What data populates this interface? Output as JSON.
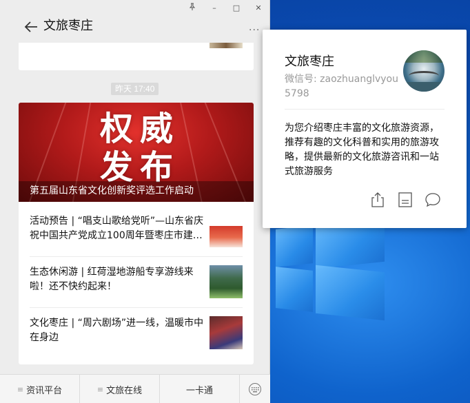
{
  "window": {
    "pin": "⊼",
    "minimize": "–",
    "maximize": "□",
    "close": "✕"
  },
  "header": {
    "title": "文旅枣庄",
    "more": "···"
  },
  "previous_card": {
    "text": "“                            ”"
  },
  "timestamp": "昨天 17:40",
  "hero": {
    "big_text_line1": "权威",
    "big_text_line2": "发布",
    "caption": "第五届山东省文化创新奖评选工作启动"
  },
  "sub_articles": [
    {
      "title": "活动预告 | “唱支山歌给党听”—山东省庆祝中国共产党成立100周年暨枣庄市建…"
    },
    {
      "title": "生态休闲游 | 红荷湿地游船专享游线来啦！还不快约起来！"
    },
    {
      "title": "文化枣庄 | “周六剧场”进一线，温暖市中在身边"
    }
  ],
  "bottom_menu": [
    {
      "label": "资讯平台",
      "icon": "≡"
    },
    {
      "label": "文旅在线",
      "icon": "≡"
    },
    {
      "label": "一卡通",
      "icon": ""
    }
  ],
  "profile": {
    "name": "文旅枣庄",
    "wechat_label": "微信号:",
    "wechat_id": "zaozhuanglvyou5798",
    "description": "为您介绍枣庄丰富的文化旅游资源，推荐有趣的文化科普和实用的旅游攻略，提供最新的文化旅游咨讯和一站式旅游服务"
  },
  "colors": {
    "hero_red": "#b11a1a",
    "desktop_blue": "#0a4fb0",
    "chat_bg": "#ededed"
  }
}
